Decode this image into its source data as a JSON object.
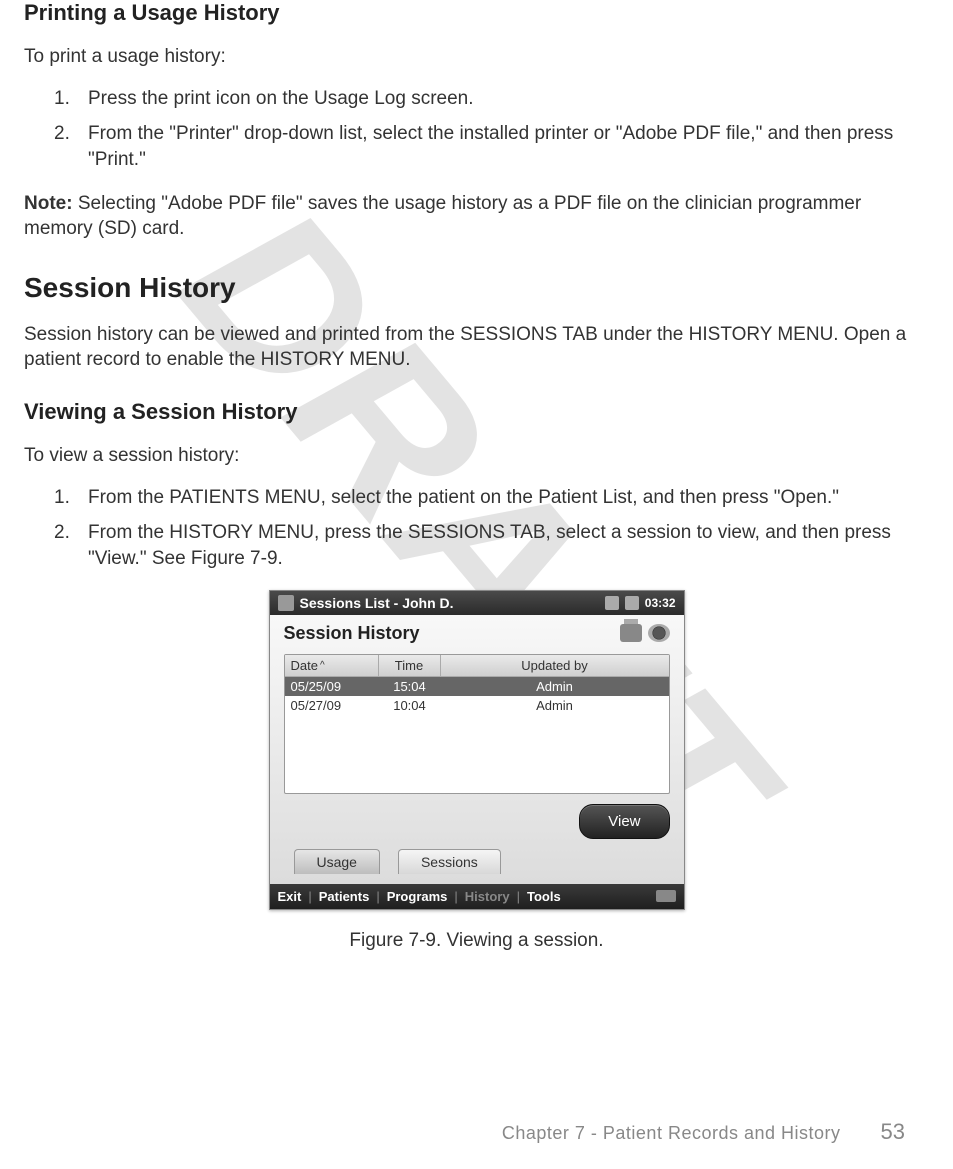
{
  "watermark": "DRAFT",
  "section1": {
    "heading": "Printing a Usage History",
    "lead": "To print a usage history:",
    "steps": [
      "Press the print icon on the Usage Log screen.",
      "From the \"Printer\" drop-down list, select the installed printer or \"Adobe PDF file,\" and then press \"Print.\""
    ],
    "note_label": "Note:",
    "note_text": " Selecting \"Adobe PDF file\" saves the usage history as a PDF file on the clinician programmer memory (SD) card."
  },
  "section2": {
    "heading": "Session History",
    "lead": "Session history can be viewed and printed from the SESSIONS TAB under the HISTORY MENU. Open a patient record to enable the HISTORY MENU."
  },
  "section3": {
    "heading": "Viewing a Session History",
    "lead": "To view a session history:",
    "steps": [
      "From the PATIENTS MENU, select the patient on the Patient List, and then press \"Open.\"",
      "From the HISTORY MENU, press the SESSIONS TAB, select a session to view, and then press \"View.\" See Figure 7-9."
    ]
  },
  "device": {
    "title": "Sessions List - John D.",
    "clock": "03:32",
    "panel_title": "Session History",
    "columns": {
      "date": "Date",
      "sort_caret": "^",
      "time": "Time",
      "updated_by": "Updated by"
    },
    "rows": [
      {
        "date": "05/25/09",
        "time": "15:04",
        "updated_by": "Admin",
        "selected": true
      },
      {
        "date": "05/27/09",
        "time": "10:04",
        "updated_by": "Admin",
        "selected": false
      }
    ],
    "view_button": "View",
    "tabs": {
      "usage": "Usage",
      "sessions": "Sessions"
    },
    "bottombar": {
      "exit": "Exit",
      "patients": "Patients",
      "programs": "Programs",
      "history": "History",
      "tools": "Tools"
    }
  },
  "figure_caption": "Figure 7-9. Viewing a session.",
  "footer": {
    "chapter": "Chapter 7 - Patient Records and History",
    "page": "53"
  }
}
